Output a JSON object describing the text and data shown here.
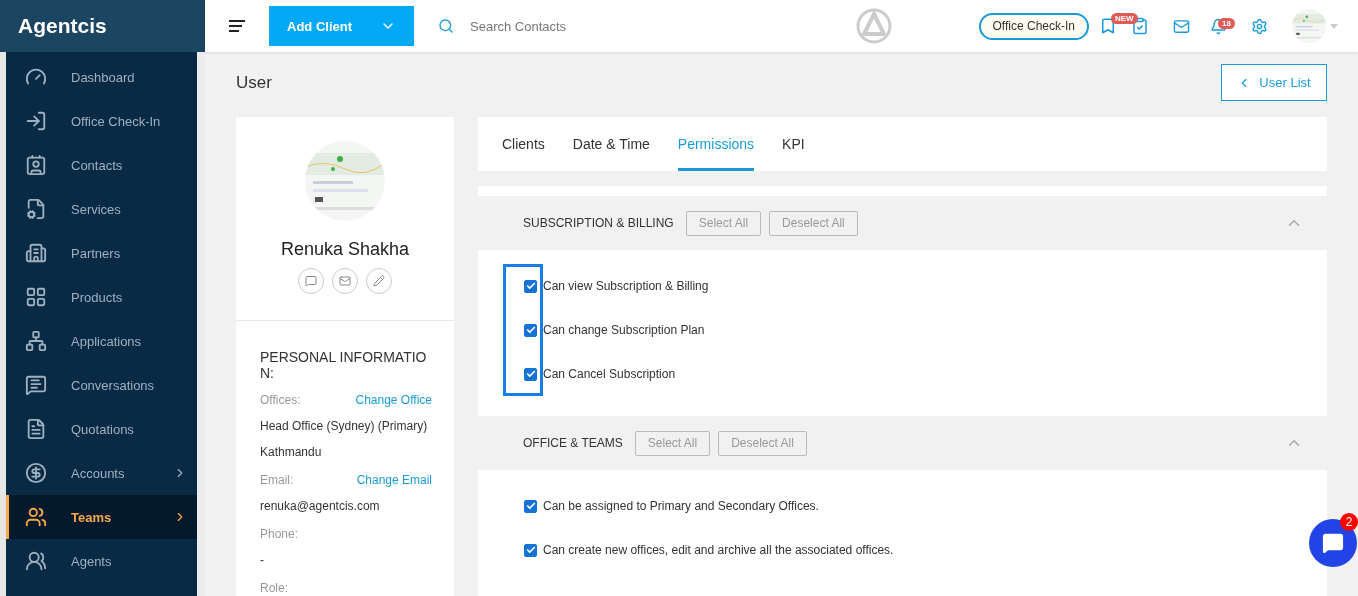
{
  "brand": "Agentcis",
  "sidebar": {
    "items": [
      {
        "label": "Dashboard",
        "selected": false,
        "has_submenu": false
      },
      {
        "label": "Office Check-In",
        "selected": false,
        "has_submenu": false
      },
      {
        "label": "Contacts",
        "selected": false,
        "has_submenu": false
      },
      {
        "label": "Services",
        "selected": false,
        "has_submenu": false
      },
      {
        "label": "Partners",
        "selected": false,
        "has_submenu": false
      },
      {
        "label": "Products",
        "selected": false,
        "has_submenu": false
      },
      {
        "label": "Applications",
        "selected": false,
        "has_submenu": false
      },
      {
        "label": "Conversations",
        "selected": false,
        "has_submenu": false
      },
      {
        "label": "Quotations",
        "selected": false,
        "has_submenu": false
      },
      {
        "label": "Accounts",
        "selected": false,
        "has_submenu": true
      },
      {
        "label": "Teams",
        "selected": true,
        "has_submenu": true
      },
      {
        "label": "Agents",
        "selected": false,
        "has_submenu": false
      }
    ]
  },
  "topbar": {
    "add_client": "Add Client",
    "search": {
      "placeholder": "Search Contacts"
    },
    "check_in": "Office Check-In",
    "new_badge": "NEW",
    "notification_count": "18"
  },
  "page": {
    "title": "User",
    "back_button": "User List"
  },
  "profile": {
    "name": "Renuka Shakha",
    "section_title": "PERSONAL INFORMATION:",
    "fields": [
      {
        "label": "Offices:",
        "action": "Change Office",
        "values": [
          "Head Office (Sydney) (Primary)",
          "Kathmandu"
        ]
      },
      {
        "label": "Email:",
        "action": "Change Email",
        "values": [
          "renuka@agentcis.com"
        ]
      },
      {
        "label": "Phone:",
        "values": [
          "-"
        ]
      },
      {
        "label": "Role:"
      }
    ]
  },
  "tabs": [
    {
      "label": "Clients",
      "selected": false
    },
    {
      "label": "Date & Time",
      "selected": false
    },
    {
      "label": "Permissions",
      "selected": true
    },
    {
      "label": "KPI",
      "selected": false
    }
  ],
  "sections": [
    {
      "title": "SUBSCRIPTION & BILLING",
      "select_all": "Select All",
      "deselect_all": "Deselect All",
      "expanded": true,
      "highlighted": true,
      "permissions": [
        {
          "label": "Can view Subscription & Billing",
          "checked": true
        },
        {
          "label": "Can change Subscription Plan",
          "checked": true
        },
        {
          "label": "Can Cancel Subscription",
          "checked": true
        }
      ]
    },
    {
      "title": "OFFICE & TEAMS",
      "select_all": "Select All",
      "deselect_all": "Deselect All",
      "expanded": true,
      "highlighted": false,
      "permissions": [
        {
          "label": "Can be assigned to Primary and Secondary Offices.",
          "checked": true
        },
        {
          "label": "Can create new offices, edit and archive all the associated offices.",
          "checked": true
        }
      ]
    }
  ],
  "chat": {
    "count": "2"
  }
}
